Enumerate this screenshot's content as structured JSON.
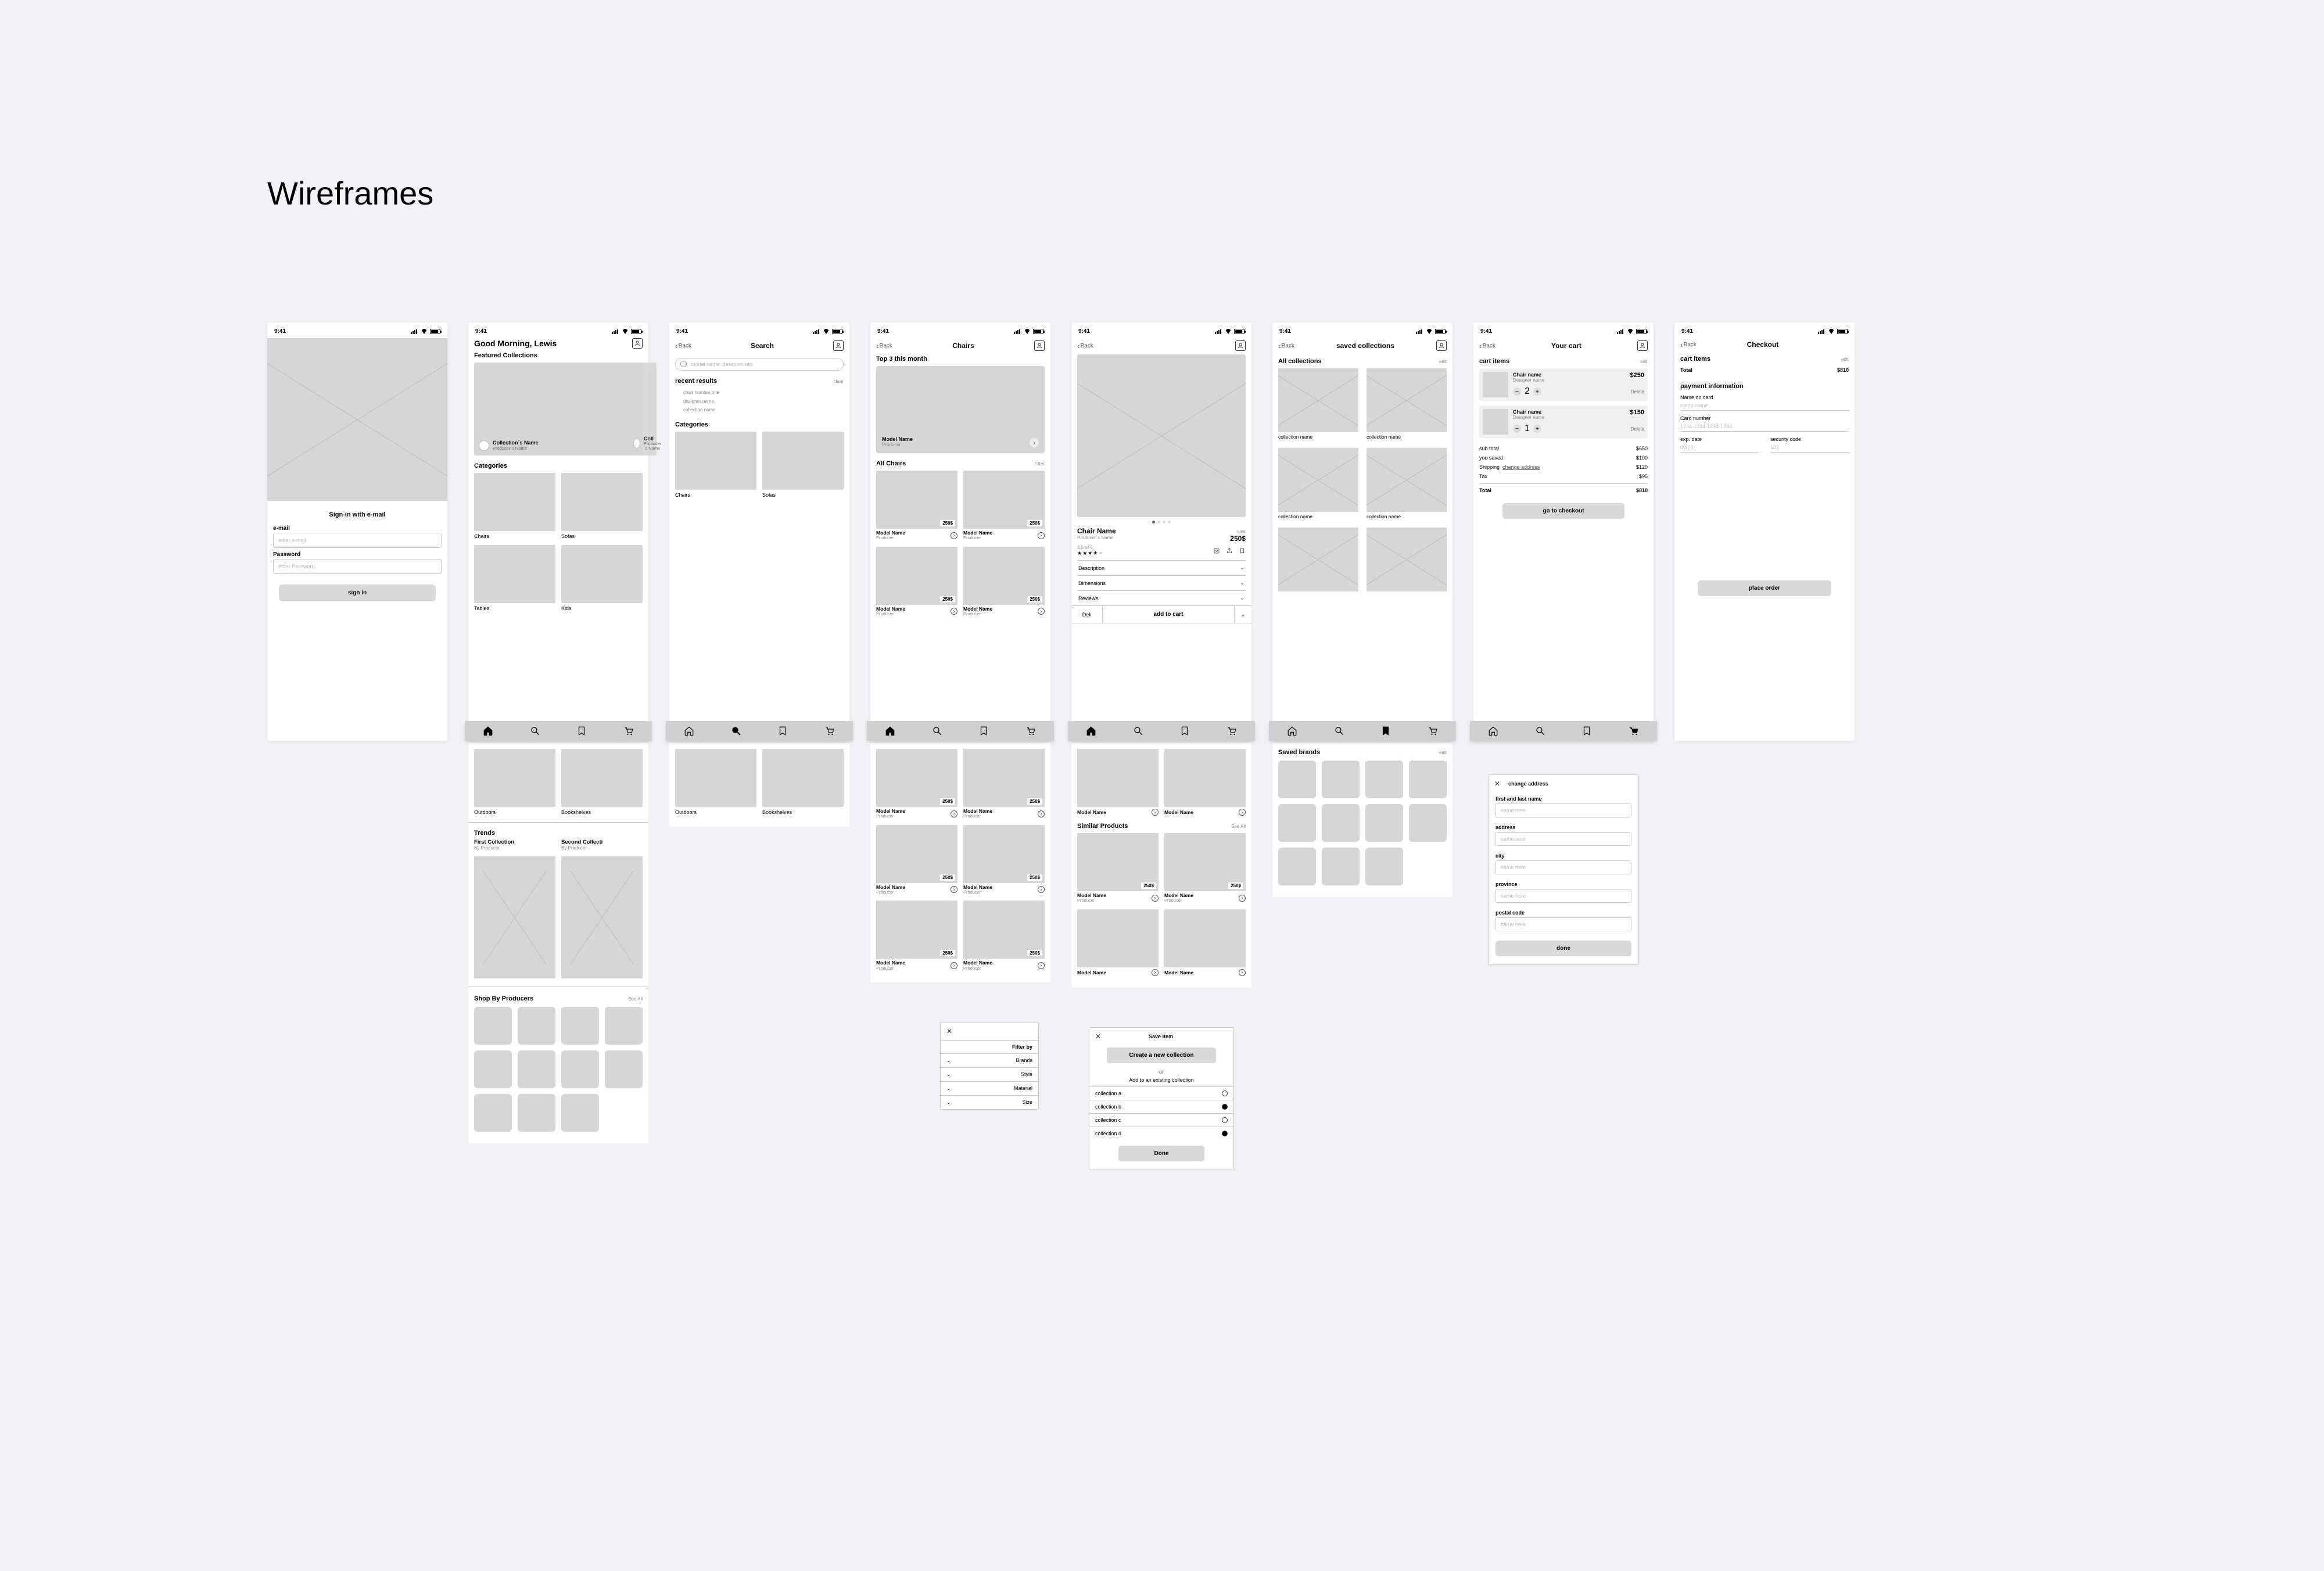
{
  "page_title": "Wireframes",
  "status": {
    "time": "9:41"
  },
  "nav": {
    "back": "Back"
  },
  "signin": {
    "title": "Sign-in with e-mail",
    "email_label": "e-mail",
    "email_ph": "enter e-mail",
    "pw_label": "Password",
    "pw_ph": "enter Password",
    "button": "sign in"
  },
  "home": {
    "greeting": "Good Morning, Lewis",
    "featured": "Featured Collections",
    "coll_name": "Collection´s Name",
    "coll_sub": "Producer´s Name",
    "coll_peek": "Coll",
    "categories": "Categories",
    "cats": [
      "Chairs",
      "Sofas",
      "Tables",
      "Kids",
      "Outdoors",
      "Bookshelves"
    ],
    "trends": "Trends",
    "trend_a": "First Collection",
    "trend_b": "Second Collecti",
    "trend_sub": "By Producer",
    "shop_by": "Shop By Producers",
    "see_all": "See All"
  },
  "search": {
    "title": "Search",
    "placeholder": "model name, designer, etc.",
    "recent": "recent results",
    "clear": "clear",
    "items": [
      "chair number one",
      "designer name",
      "collection name"
    ],
    "categories": "Categories",
    "cats": [
      "Chairs",
      "Sofas",
      "Outdoors",
      "Bookshelves"
    ]
  },
  "listing": {
    "title": "Chairs",
    "top3": "Top 3 this month",
    "hero_name": "Model Name",
    "hero_sub": "Producer",
    "all": "All Chairs",
    "filter": "Filter",
    "price": "250$",
    "model": "Model Name",
    "producer": "Producer"
  },
  "product": {
    "title": "Chair Name",
    "subtitle": "Producer´s Name",
    "rating": "4.5 of 5",
    "price": "250$",
    "unit": "Unit",
    "desc": "Description",
    "dims": "Dimensions",
    "reviews": "Reviews",
    "delivery": "Deli",
    "add": "add to cart",
    "similar": "Similar Products",
    "see_all": "See All",
    "model": "Model Name",
    "producer": "Producer",
    "p": "250$"
  },
  "saved": {
    "title": "saved collections",
    "all": "All collections",
    "edit": "edit",
    "coll": "collection name",
    "brands": "Saved brands"
  },
  "cart": {
    "title": "Your cart",
    "items": "cart items",
    "edit": "edit",
    "item_name": "Chair name",
    "item_sub": "Designer name",
    "q1": "2",
    "p1": "$250",
    "q2": "1",
    "p2": "$150",
    "delete": "Delete",
    "subtotal": "sub total",
    "subtotal_v": "$650",
    "saved": "you saved",
    "saved_v": "$100",
    "ship": "Shipping",
    "ship_link": "change address",
    "ship_v": "$120",
    "tax": "Tax",
    "tax_v": "$95",
    "total": "Total",
    "total_v": "$810",
    "checkout": "go to checkout"
  },
  "checkout": {
    "title": "Checkout",
    "items": "cart items",
    "edit": "edit",
    "total": "Total",
    "total_v": "$810",
    "pi": "payment information",
    "noc": "Name on card",
    "noc_ph": "name name",
    "cn": "Card number",
    "cn_ph": "1234-1234-1234-1234",
    "exp": "exp. date",
    "exp_ph": "00/00",
    "sec": "security code",
    "sec_ph": "123",
    "place": "place order"
  },
  "filter": {
    "title": "Filter by",
    "rows": [
      "Brands",
      "Style",
      "Material",
      "Size"
    ]
  },
  "save_modal": {
    "title": "Save Item",
    "create": "Create a new collection",
    "or": "or",
    "add_existing": "Add to an existing collection",
    "rows": [
      "collection a",
      "collection b",
      "collection c",
      "collection d"
    ],
    "done": "Done"
  },
  "addr": {
    "title": "change address",
    "f1": "first and last name",
    "f2": "address",
    "f3": "city",
    "f4": "province",
    "f5": "postal code",
    "ph": "name here",
    "done": "done"
  }
}
